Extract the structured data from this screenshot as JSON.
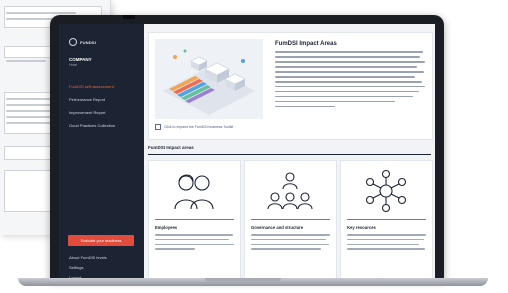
{
  "app": {
    "brand": "FUNDSI",
    "company": "COMPANY",
    "company_sub": "Hotel"
  },
  "sidebar": {
    "items": [
      {
        "label": "FumDSI self-assessment",
        "active": true
      },
      {
        "label": "Performance Report",
        "active": false
      },
      {
        "label": "Improvement Report",
        "active": false
      },
      {
        "label": "Good Practices Collection",
        "active": false
      }
    ],
    "cta": "Evaluate your readiness",
    "bottom": [
      "About FumDSI levels",
      "Settings",
      "Logout"
    ]
  },
  "hero": {
    "title": "FumDSI Impact Areas",
    "caption": "Click to expand the FumDSI business Toolkit"
  },
  "section": {
    "title": "FumDSI Impact areas"
  },
  "cards": [
    {
      "title": "Employees",
      "icon": "employees-icon"
    },
    {
      "title": "Governance and structure",
      "icon": "governance-icon"
    },
    {
      "title": "Key resources",
      "icon": "key-resources-icon"
    }
  ],
  "colors": {
    "sidebar": "#1c2433",
    "accent": "#e24c3c",
    "active_nav": "#e8633f",
    "main_bg": "#f2f3f6"
  }
}
